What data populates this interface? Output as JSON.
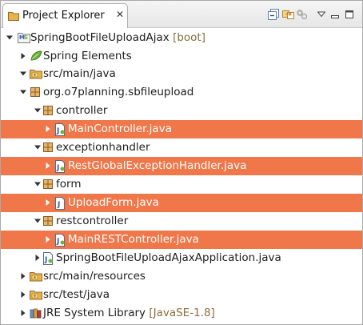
{
  "view": {
    "title": "Project Explorer",
    "close_glyph": "✕",
    "toolbar": [
      {
        "icon": "collapse-all-icon"
      },
      {
        "icon": "link-with-editor-icon"
      },
      {
        "icon": "gear-icon"
      },
      {
        "icon": "view-menu-icon"
      },
      {
        "icon": "minimize-icon"
      },
      {
        "icon": "maximize-icon"
      }
    ]
  },
  "colors": {
    "selection": "#f0774a",
    "package": "#b07a2a",
    "folder": "#e8b24c",
    "spring": "#6db33f"
  },
  "tree": [
    {
      "label": "SpringBootFileUploadAjax",
      "decoration": "[boot]",
      "icon": "spring-boot-project-icon",
      "expanded": true,
      "level": 0,
      "selected": false
    },
    {
      "label": "Spring Elements",
      "icon": "spring-leaf-icon",
      "expanded": false,
      "level": 1,
      "selected": false
    },
    {
      "label": "src/main/java",
      "icon": "source-folder-icon",
      "expanded": true,
      "level": 1,
      "selected": false
    },
    {
      "label": "org.o7planning.sbfileupload",
      "icon": "package-icon",
      "expanded": true,
      "level": 2,
      "selected": false
    },
    {
      "label": "controller",
      "icon": "package-icon",
      "expanded": true,
      "level": 3,
      "selected": false
    },
    {
      "label": "MainController.java",
      "icon": "spring-java-file-icon",
      "expanded": false,
      "level": 4,
      "selected": true
    },
    {
      "label": "exceptionhandler",
      "icon": "package-icon",
      "expanded": true,
      "level": 3,
      "selected": false
    },
    {
      "label": "RestGlobalExceptionHandler.java",
      "icon": "spring-java-file-icon",
      "expanded": false,
      "level": 4,
      "selected": true
    },
    {
      "label": "form",
      "icon": "package-icon",
      "expanded": true,
      "level": 3,
      "selected": false
    },
    {
      "label": "UploadForm.java",
      "icon": "java-file-icon",
      "expanded": false,
      "level": 4,
      "selected": true
    },
    {
      "label": "restcontroller",
      "icon": "package-icon",
      "expanded": true,
      "level": 3,
      "selected": false
    },
    {
      "label": "MainRESTController.java",
      "icon": "spring-java-file-icon",
      "expanded": false,
      "level": 4,
      "selected": true
    },
    {
      "label": "SpringBootFileUploadAjaxApplication.java",
      "icon": "spring-java-file-icon",
      "expanded": false,
      "level": 3,
      "selected": false
    },
    {
      "label": "src/main/resources",
      "icon": "source-folder-icon",
      "expanded": false,
      "level": 1,
      "selected": false
    },
    {
      "label": "src/test/java",
      "icon": "source-folder-icon",
      "expanded": false,
      "level": 1,
      "selected": false
    },
    {
      "label": "JRE System Library",
      "decoration": "[JavaSE-1.8]",
      "icon": "library-icon",
      "expanded": false,
      "level": 1,
      "selected": false
    }
  ]
}
